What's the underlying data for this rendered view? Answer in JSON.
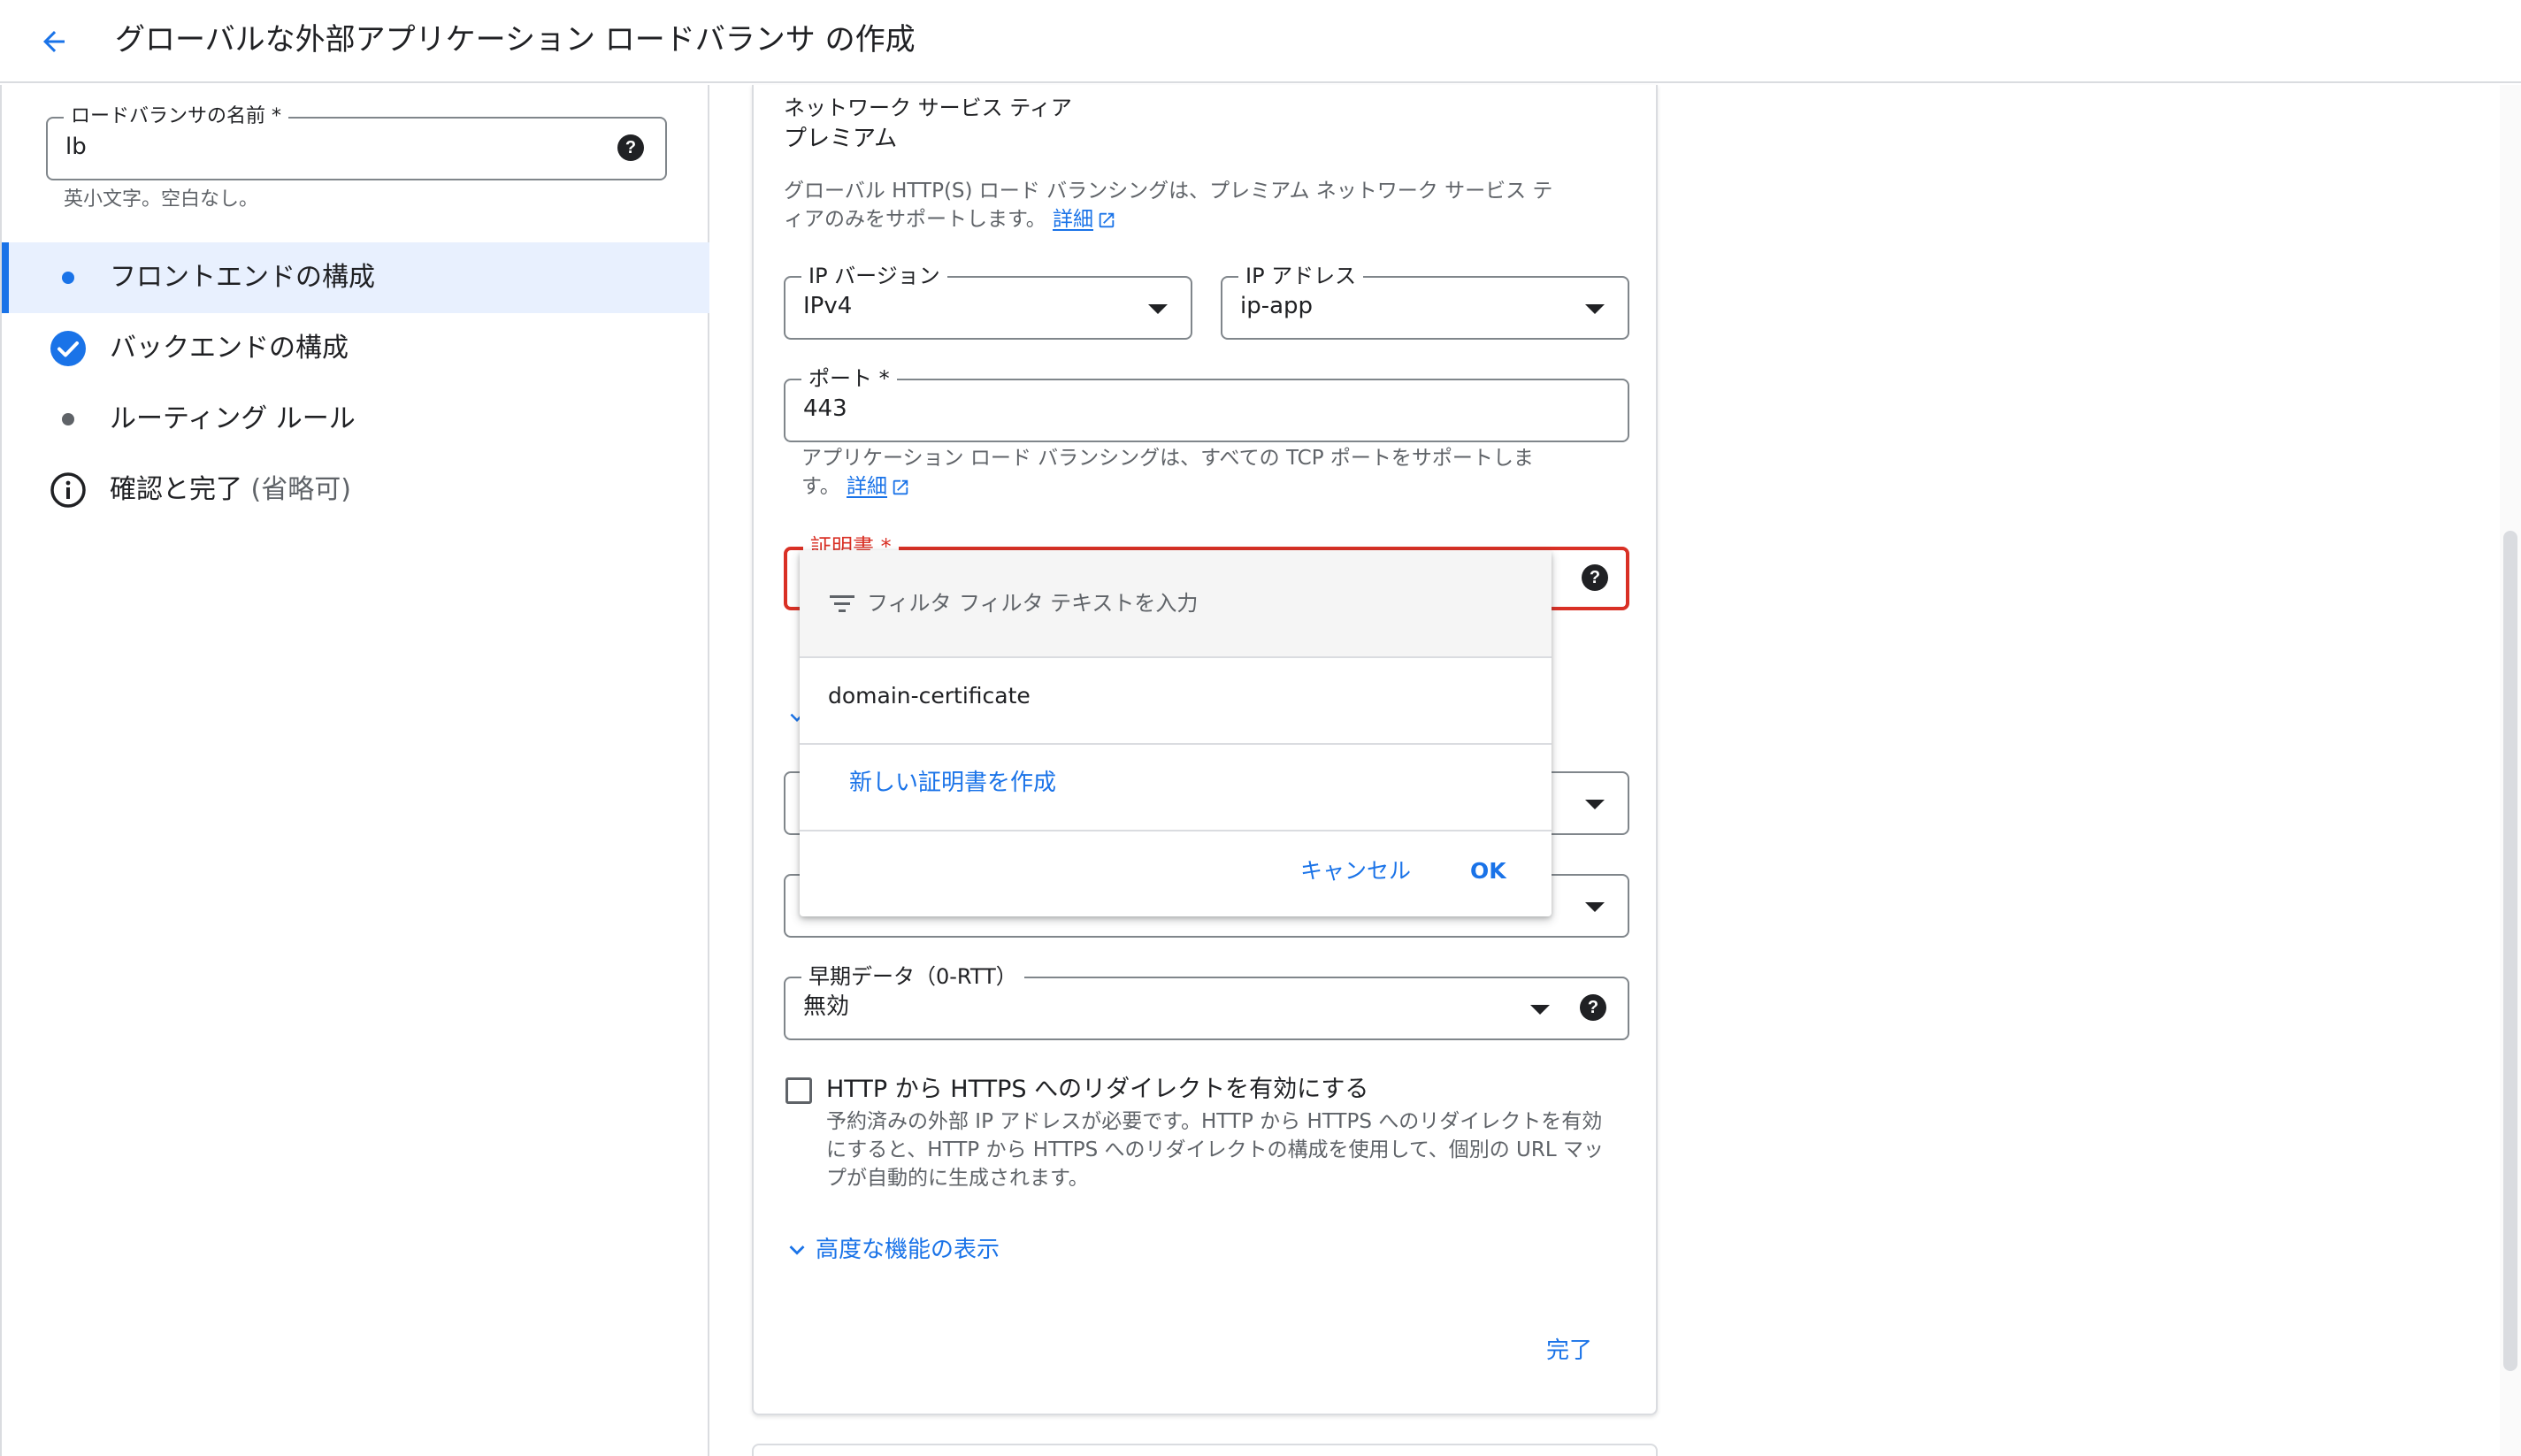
{
  "header": {
    "title": "グローバルな外部アプリケーション ロードバランサ の作成"
  },
  "left": {
    "name_field": {
      "label": "ロードバランサの名前 *",
      "value": "lb",
      "hint": "英小文字。空白なし。"
    },
    "steps": [
      {
        "label": "フロントエンドの構成",
        "icon": "dot-icon",
        "state": "active"
      },
      {
        "label": "バックエンドの構成",
        "icon": "check-circle-icon",
        "state": "done"
      },
      {
        "label": "ルーティング ルール",
        "icon": "dot-icon",
        "state": "pending"
      },
      {
        "label": "確認と完了",
        "suffix": "(省略可)",
        "icon": "info-icon",
        "state": "pending"
      }
    ]
  },
  "main": {
    "network_tier": {
      "label": "ネットワーク サービス ティア",
      "value": "プレミアム",
      "desc_line1": "グローバル HTTP(S) ロード バランシングは、プレミアム ネットワーク サービス テ",
      "desc_line2": "ィアのみをサポートします。",
      "link": "詳細"
    },
    "ip_version": {
      "label": "IP バージョン",
      "value": "IPv4"
    },
    "ip_address": {
      "label": "IP アドレス",
      "value": "ip-app"
    },
    "port": {
      "label": "ポート *",
      "value": "443",
      "hint_line1": "アプリケーション ロード バランシングは、すべての TCP ポートをサポートしま",
      "hint_line2": "す。",
      "link": "詳細"
    },
    "certificate": {
      "label": "証明書 *"
    },
    "early_data": {
      "label": "早期データ（0-RTT）",
      "value": "無効"
    },
    "redirect": {
      "label": "HTTP から HTTPS へのリダイレクトを有効にする",
      "desc_line1": "予約済みの外部 IP アドレスが必要です。HTTP から HTTPS へのリダイレクトを有効",
      "desc_line2": "にすると、HTTP から HTTPS へのリダイレクトの構成を使用して、個別の URL マッ",
      "desc_line3": "プが自動的に生成されます。",
      "checked": false
    },
    "advanced_toggle": "高度な機能の表示",
    "done_button": "完了"
  },
  "popup": {
    "filter_label": "フィルタ",
    "filter_placeholder": "フィルタ テキストを入力",
    "options": [
      "domain-certificate"
    ],
    "create_new": "新しい証明書を作成",
    "cancel": "キャンセル",
    "ok": "OK"
  },
  "colors": {
    "accent": "#1a73e8",
    "error": "#d93025",
    "text": "#202124",
    "muted": "#5f6368"
  }
}
